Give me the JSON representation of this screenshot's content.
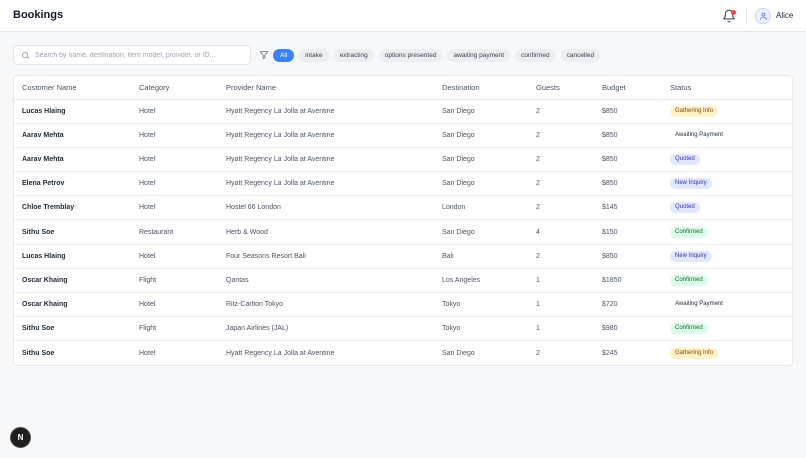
{
  "header": {
    "title": "Bookings",
    "user_name": "Alice"
  },
  "search": {
    "placeholder": "Search by name, destination, item model, provider, or ID...",
    "value": ""
  },
  "filters": [
    {
      "label": "All",
      "active": true
    },
    {
      "label": "intake",
      "active": false
    },
    {
      "label": "extracting",
      "active": false
    },
    {
      "label": "options presented",
      "active": false
    },
    {
      "label": "awaiting payment",
      "active": false
    },
    {
      "label": "confirmed",
      "active": false
    },
    {
      "label": "cancelled",
      "active": false
    }
  ],
  "table": {
    "columns": [
      "Customer Name",
      "Category",
      "Provider Name",
      "Destination",
      "Guests",
      "Budget",
      "Status"
    ],
    "rows": [
      {
        "customer": "Lucas Hlaing",
        "category": "Hotel",
        "provider": "Hyatt Regency La Jolla at Aventine",
        "destination": "San Diego",
        "guests": "2",
        "budget": "$850",
        "status": "Gathering Info",
        "status_kind": "gathering"
      },
      {
        "customer": "Aarav Mehta",
        "category": "Hotel",
        "provider": "Hyatt Regency La Jolla at Aventine",
        "destination": "San Diego",
        "guests": "2",
        "budget": "$850",
        "status": "Awaiting Payment",
        "status_kind": "awaiting"
      },
      {
        "customer": "Aarav Mehta",
        "category": "Hotel",
        "provider": "Hyatt Regency La Jolla at Aventine",
        "destination": "San Diego",
        "guests": "2",
        "budget": "$850",
        "status": "Quoted",
        "status_kind": "quoted"
      },
      {
        "customer": "Elena Petrov",
        "category": "Hotel",
        "provider": "Hyatt Regency La Jolla at Aventine",
        "destination": "San Diego",
        "guests": "2",
        "budget": "$850",
        "status": "New Inquiry",
        "status_kind": "newinq"
      },
      {
        "customer": "Chloe Tremblay",
        "category": "Hotel",
        "provider": "Hostel 66 London",
        "destination": "London",
        "guests": "2",
        "budget": "$145",
        "status": "Quoted",
        "status_kind": "quoted"
      },
      {
        "customer": "Sithu Soe",
        "category": "Restaurant",
        "provider": "Herb & Wood",
        "destination": "San Diego",
        "guests": "4",
        "budget": "$150",
        "status": "Confirmed",
        "status_kind": "confirmed"
      },
      {
        "customer": "Lucas Hlaing",
        "category": "Hotel",
        "provider": "Four Seasons Resort Bali",
        "destination": "Bali",
        "guests": "2",
        "budget": "$850",
        "status": "New Inquiry",
        "status_kind": "newinq"
      },
      {
        "customer": "Oscar Khaing",
        "category": "Flight",
        "provider": "Qantas",
        "destination": "Los Angeles",
        "guests": "1",
        "budget": "$1850",
        "status": "Confirmed",
        "status_kind": "confirmed"
      },
      {
        "customer": "Oscar Khaing",
        "category": "Hotel",
        "provider": "Ritz-Carlton Tokyo",
        "destination": "Tokyo",
        "guests": "1",
        "budget": "$720",
        "status": "Awaiting Payment",
        "status_kind": "awaiting"
      },
      {
        "customer": "Sithu Soe",
        "category": "Flight",
        "provider": "Japan Airlines (JAL)",
        "destination": "Tokyo",
        "guests": "1",
        "budget": "$980",
        "status": "Confirmed",
        "status_kind": "confirmed"
      },
      {
        "customer": "Sithu Soe",
        "category": "Hotel",
        "provider": "Hyatt Regency La Jolla at Aventine",
        "destination": "San Diego",
        "guests": "2",
        "budget": "$245",
        "status": "Gathering Info",
        "status_kind": "gathering"
      }
    ]
  },
  "fab": {
    "label": "N"
  },
  "icons": {
    "notification": "bell-icon",
    "user": "user-icon",
    "search": "search-icon",
    "filter": "filter-icon"
  },
  "colors": {
    "accent": "#3b82f6",
    "notification_dot": "#ef4444"
  }
}
